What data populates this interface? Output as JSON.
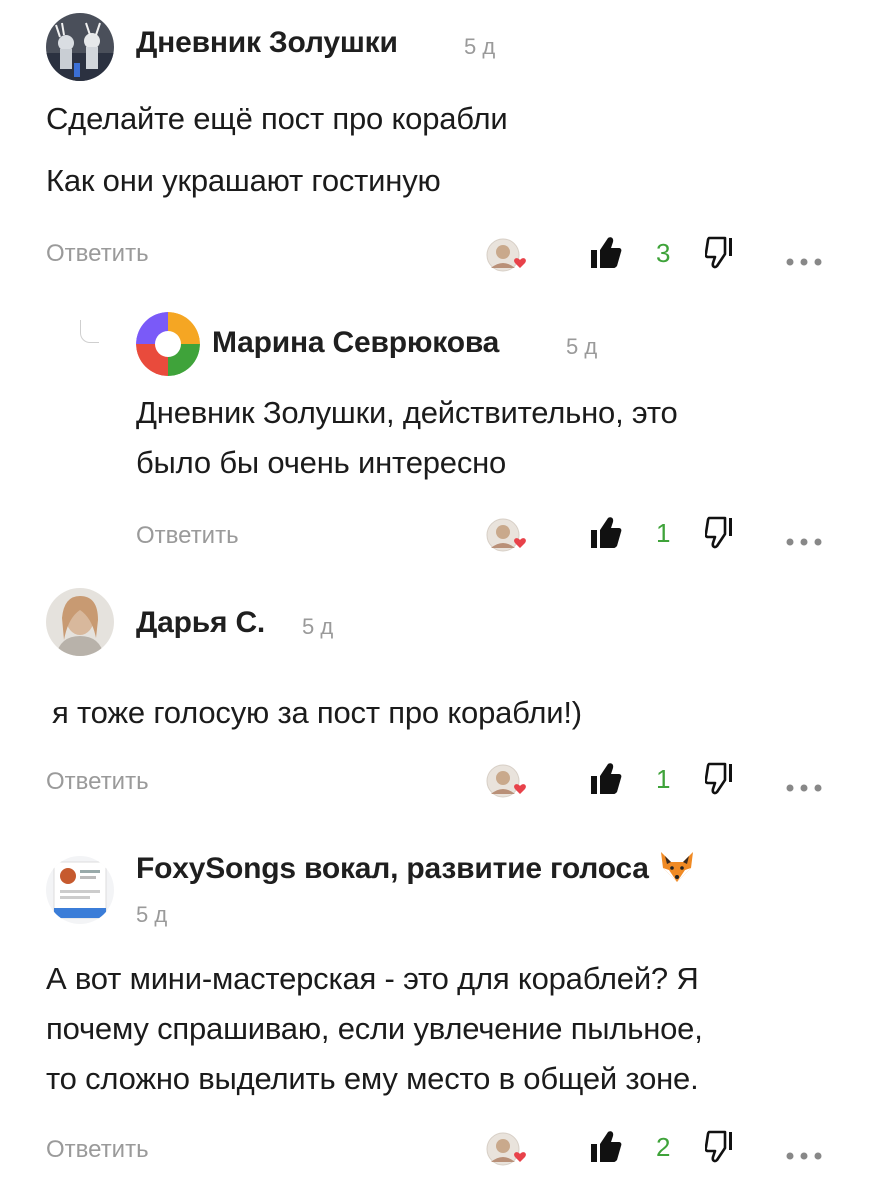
{
  "comments": [
    {
      "author": "Дневник Золушки",
      "time": "5 д",
      "lines": [
        "Сделайте ещё пост про корабли",
        "Как они украшают гостиную"
      ],
      "reply_label": "Ответить",
      "likes": "3"
    },
    {
      "author": "Марина Севрюкова",
      "time": "5 д",
      "lines": [
        "Дневник Золушки, действительно, это",
        "было бы очень интересно"
      ],
      "reply_label": "Ответить",
      "likes": "1"
    },
    {
      "author": "Дарья С.",
      "time": "5 д",
      "lines": [
        "я тоже голосую за пост про корабли!)"
      ],
      "reply_label": "Ответить",
      "likes": "1"
    },
    {
      "author": "FoxySongs вокал, развитие голоса",
      "time": "5 д",
      "lines": [
        "А вот мини-мастерская - это для кораблей? Я",
        "почему спрашиваю, если увлечение пыльное,",
        "то сложно выделить ему место в общей зоне."
      ],
      "reply_label": "Ответить",
      "likes": "2"
    }
  ],
  "icons": {
    "like": "thumbs-up-icon",
    "dislike": "thumbs-down-icon",
    "more": "more-dots-icon",
    "author_like": "author-heart-icon",
    "fox": "fox-emoji"
  },
  "colors": {
    "like_count": "#3fa33a",
    "muted": "#9a9a9a",
    "heart": "#e8424a"
  }
}
